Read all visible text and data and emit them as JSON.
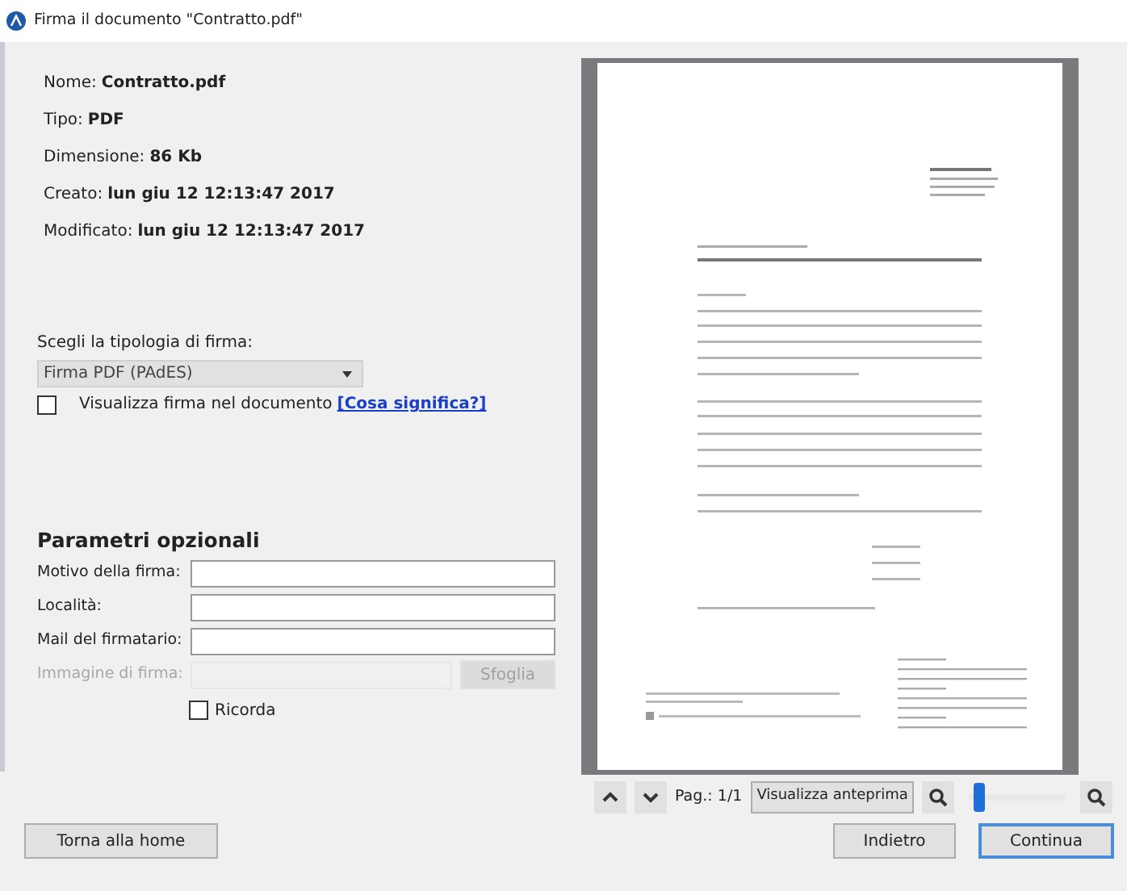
{
  "window": {
    "title": "Firma il documento \"Contratto.pdf\""
  },
  "file_info": [
    {
      "label": "Nome:",
      "value": "Contratto.pdf"
    },
    {
      "label": "Tipo:",
      "value": "PDF"
    },
    {
      "label": "Dimensione:",
      "value": "86 Kb"
    },
    {
      "label": "Creato:",
      "value": "lun giu 12 12:13:47 2017"
    },
    {
      "label": "Modificato:",
      "value": "lun giu 12 12:13:47 2017"
    }
  ],
  "signature_type": {
    "label": "Scegli la tipologia di firma:",
    "value": "Firma PDF (PAdES)",
    "show_in_document": {
      "label": "Visualizza firma nel documento",
      "checked": false
    },
    "help_link": "[Cosa significa?]"
  },
  "optional_parameters": {
    "title": "Parametri opzionali",
    "fields": [
      {
        "label": "Motivo della firma:",
        "disabled": false
      },
      {
        "label": "Località:",
        "disabled": false
      },
      {
        "label": "Mail del firmatario:",
        "disabled": false
      },
      {
        "label": "Immagine di firma:",
        "disabled": true,
        "button": "Sfoglia"
      }
    ],
    "remember": {
      "label": "Ricorda",
      "checked": false
    }
  },
  "preview_toolbar": {
    "page": "Pag.: 1/1",
    "preview_button": "Visualizza anteprima",
    "zoom": {
      "level": 0.05
    }
  },
  "buttons": [
    {
      "label": "Torna alla home",
      "default": false
    },
    {
      "label": "Indietro",
      "default": false
    },
    {
      "label": "Continua",
      "default": true
    }
  ]
}
